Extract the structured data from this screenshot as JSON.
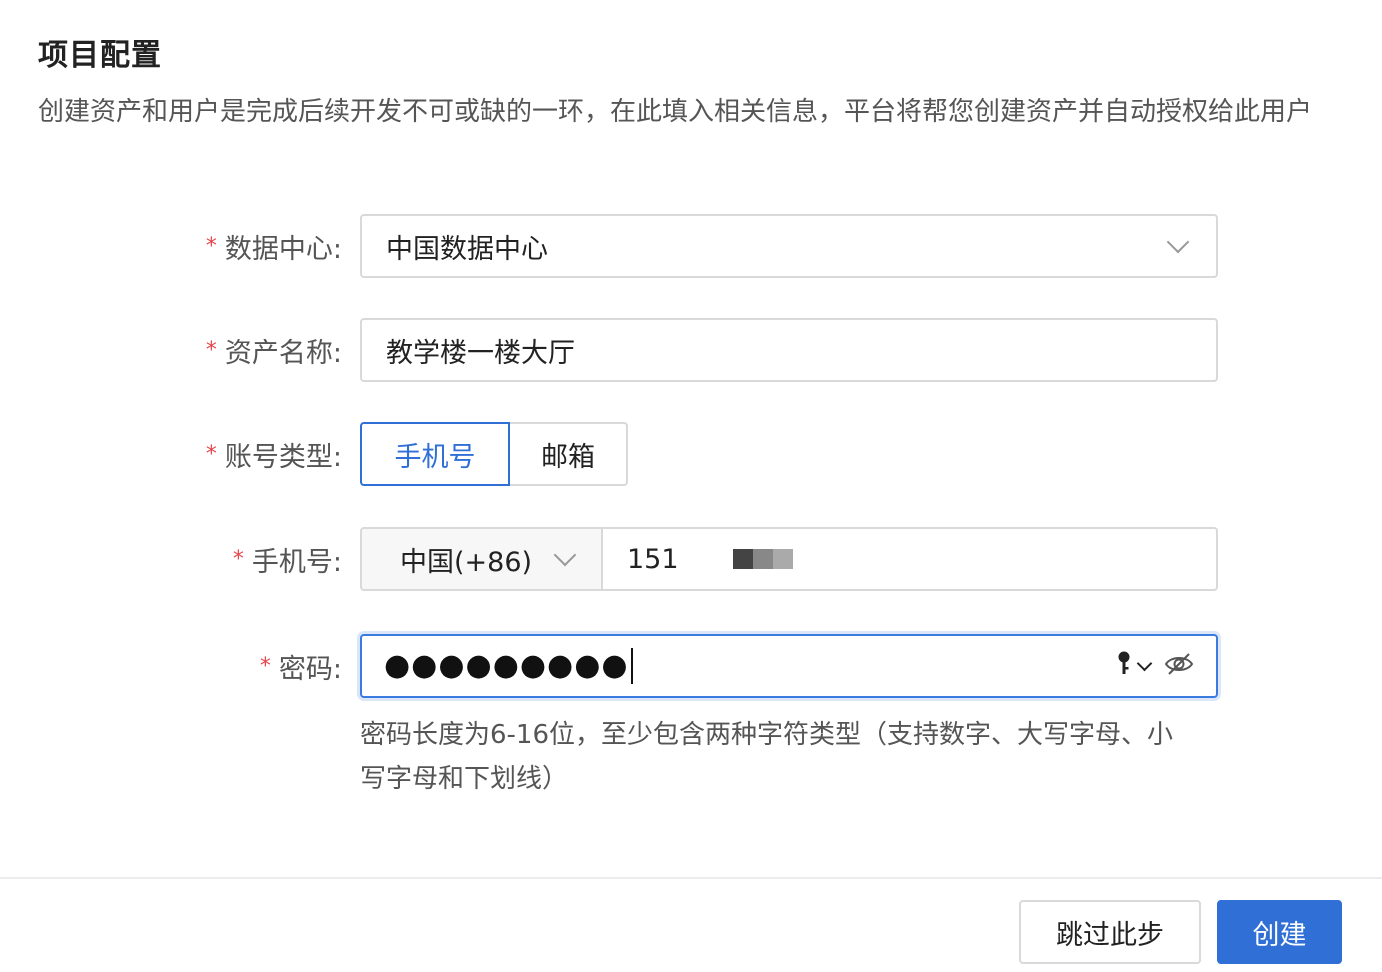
{
  "header": {
    "title": "项目配置",
    "description": "创建资产和用户是完成后续开发不可或缺的一环，在此填入相关信息，平台将帮您创建资产并自动授权给此用户"
  },
  "form": {
    "required_mark": "*",
    "datacenter": {
      "label": "数据中心:",
      "value": "中国数据中心"
    },
    "asset_name": {
      "label": "资产名称:",
      "value": "教学楼一楼大厅"
    },
    "account_type": {
      "label": "账号类型:",
      "options": [
        "手机号",
        "邮箱"
      ],
      "selected": "手机号"
    },
    "phone": {
      "label": "手机号:",
      "country_code": "中国(+86)",
      "value": "151"
    },
    "password": {
      "label": "密码:",
      "masked_value": "●●●●●●●●●",
      "key_icon": "key-icon",
      "visibility_icon": "eye-off-icon",
      "hint": "密码长度为6-16位，至少包含两种字符类型（支持数字、大写字母、小写字母和下划线）"
    }
  },
  "footer": {
    "skip_label": "跳过此步",
    "create_label": "创建"
  },
  "colors": {
    "primary": "#2f6fd6",
    "required": "#e5484d",
    "border": "#d9d9d9"
  }
}
